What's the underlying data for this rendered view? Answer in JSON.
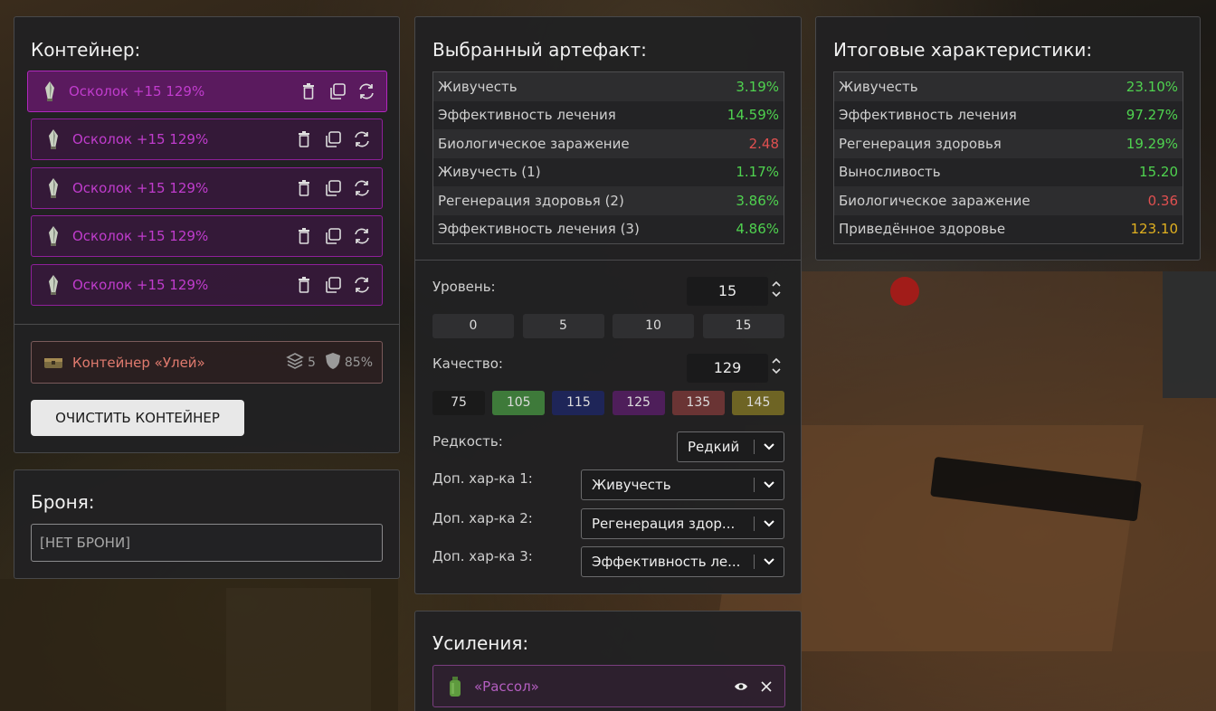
{
  "colors": {
    "green": "#4fd24f",
    "red": "#e05050",
    "gold": "#e0b020",
    "shard": "#c03ccd",
    "hive": "#e07a6e"
  },
  "container": {
    "title": "Контейнер:",
    "shards": [
      {
        "label": "Осколок +15 129%",
        "active": true
      },
      {
        "label": "Осколок +15 129%",
        "active": false
      },
      {
        "label": "Осколок +15 129%",
        "active": false
      },
      {
        "label": "Осколок +15 129%",
        "active": false
      },
      {
        "label": "Осколок +15 129%",
        "active": false
      }
    ],
    "hive": {
      "label": "Контейнер «Улей»",
      "slots": "5",
      "protection": "85%"
    },
    "clear_label": "ОЧИСТИТЬ КОНТЕЙНЕР"
  },
  "armor": {
    "title": "Броня:",
    "value": "[НЕТ БРОНИ]"
  },
  "artifact": {
    "title": "Выбранный артефакт:",
    "stats": [
      {
        "name": "Живучесть",
        "value": "3.19%",
        "color": "green"
      },
      {
        "name": "Эффективность лечения",
        "value": "14.59%",
        "color": "green"
      },
      {
        "name": "Биологическое заражение",
        "value": "2.48",
        "color": "red"
      },
      {
        "name": "Живучесть (1)",
        "value": "1.17%",
        "color": "green"
      },
      {
        "name": "Регенерация здоровья (2)",
        "value": "3.86%",
        "color": "green"
      },
      {
        "name": "Эффективность лечения (3)",
        "value": "4.86%",
        "color": "green"
      }
    ],
    "level_label": "Уровень:",
    "level_value": "15",
    "level_presets": [
      "0",
      "5",
      "10",
      "15"
    ],
    "quality_label": "Качество:",
    "quality_value": "129",
    "quality_presets": [
      {
        "label": "75",
        "bg": "#1a1a1a"
      },
      {
        "label": "105",
        "bg": "#3e7a3a"
      },
      {
        "label": "115",
        "bg": "#1e2558"
      },
      {
        "label": "125",
        "bg": "#4e1e5a"
      },
      {
        "label": "135",
        "bg": "#6a3434"
      },
      {
        "label": "145",
        "bg": "#6e6424"
      }
    ],
    "rarity_label": "Редкость:",
    "rarity_value": "Редкий",
    "extra1_label": "Доп. хар-ка 1:",
    "extra1_value": "Живучесть",
    "extra2_label": "Доп. хар-ка 2:",
    "extra2_value": "Регенерация здор...",
    "extra3_label": "Доп. хар-ка 3:",
    "extra3_value": "Эффективность ле..."
  },
  "totals": {
    "title": "Итоговые характеристики:",
    "stats": [
      {
        "name": "Живучесть",
        "value": "23.10%",
        "color": "green"
      },
      {
        "name": "Эффективность лечения",
        "value": "97.27%",
        "color": "green"
      },
      {
        "name": "Регенерация здоровья",
        "value": "19.29%",
        "color": "green"
      },
      {
        "name": "Выносливость",
        "value": "15.20",
        "color": "green"
      },
      {
        "name": "Биологическое заражение",
        "value": "0.36",
        "color": "red"
      },
      {
        "name": "Приведённое здоровье",
        "value": "123.10",
        "color": "gold"
      }
    ]
  },
  "boosts": {
    "title": "Усиления:",
    "items": [
      {
        "label": "«Рассол»"
      }
    ]
  }
}
